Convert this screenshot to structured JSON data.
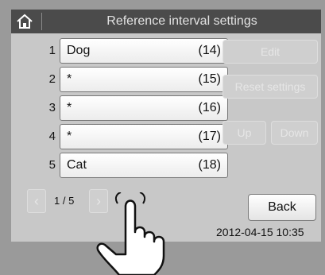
{
  "header": {
    "title": "Reference interval settings",
    "home_icon": "home-icon"
  },
  "rows": [
    {
      "number": "1",
      "name": "Dog",
      "interval": "(14)"
    },
    {
      "number": "2",
      "name": "*",
      "interval": "(15)"
    },
    {
      "number": "3",
      "name": "*",
      "interval": "(16)"
    },
    {
      "number": "4",
      "name": "*",
      "interval": "(17)"
    },
    {
      "number": "5",
      "name": "Cat",
      "interval": "(18)"
    }
  ],
  "buttons": {
    "edit": "Edit",
    "reset": "Reset settings",
    "up": "Up",
    "down": "Down",
    "back": "Back"
  },
  "pager": {
    "page": "1 / 5",
    "prev_icon": "chevron-left-icon",
    "next_icon": "chevron-right-icon"
  },
  "datetime": "2012-04-15 10:35",
  "colors": {
    "header_bg": "#4b4b4b",
    "screen_bg": "#c8c8c8",
    "disabled_text": "#e6e6e6"
  }
}
